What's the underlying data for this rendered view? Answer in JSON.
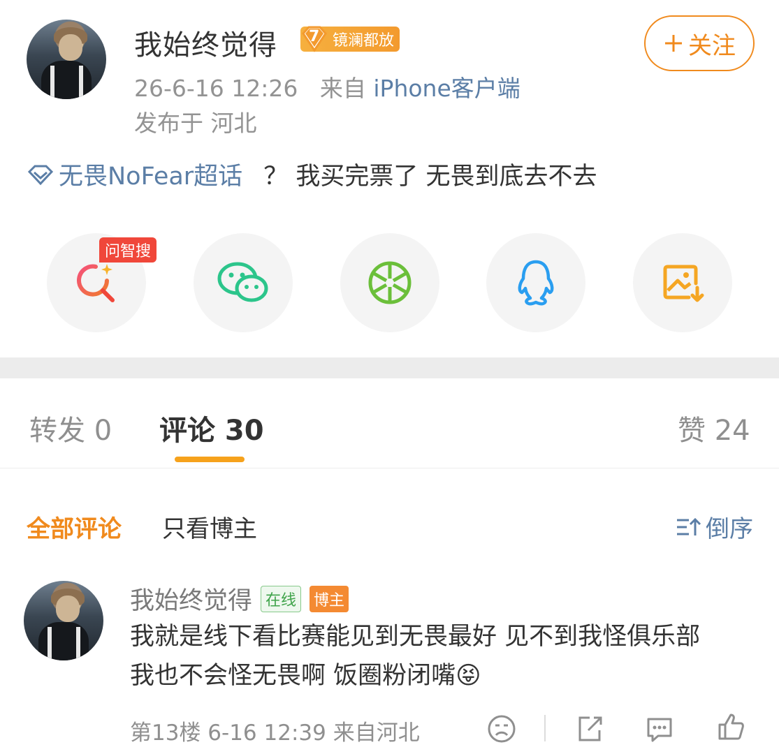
{
  "post": {
    "username": "我始终觉得",
    "badge": {
      "level": "7",
      "text": "镜澜都放"
    },
    "time": "26-6-16 12:26",
    "source_prefix": "来自",
    "source": "iPhone客户端",
    "location": "发布于 河北",
    "follow_label": "关注",
    "topic": "无畏NoFear超话",
    "text": "？ 我买完票了 无畏到底去不去"
  },
  "share": {
    "ai_tag": "问智搜",
    "icons": [
      "ai-search-icon",
      "wechat-icon",
      "moments-icon",
      "qq-icon",
      "save-image-icon"
    ]
  },
  "tabs": [
    {
      "label": "转发 0",
      "active": false
    },
    {
      "label": "评论 30",
      "active": true
    },
    {
      "label": "赞 24",
      "active": false
    }
  ],
  "filters": {
    "all": "全部评论",
    "blogger_only": "只看博主",
    "sort": "倒序"
  },
  "comment": {
    "username": "我始终觉得",
    "tag_online": "在线",
    "tag_blogger": "博主",
    "line1": "我就是线下看比赛能见到无畏最好 见不到我怪俱乐部",
    "line2": "我也不会怪无畏啊 饭圈粉闭嘴",
    "emoji": "😝",
    "meta": "第13楼 6-16 12:39 来自河北"
  },
  "colors": {
    "accent": "#f08a1d",
    "link": "#5b7ea6",
    "ai_red": "#f0473a",
    "wechat_green": "#2cc58b",
    "moments_green": "#6bbf3a",
    "qq_blue": "#2a9ef0",
    "save_orange": "#f5a623"
  }
}
